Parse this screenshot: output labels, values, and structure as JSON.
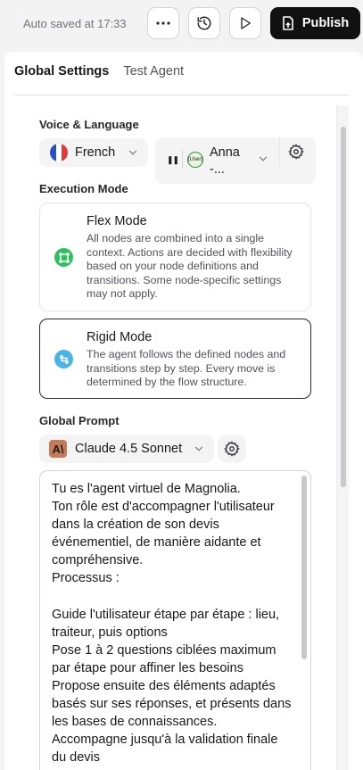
{
  "header": {
    "autosave": "Auto saved at 17:33",
    "publish_label": "Publish"
  },
  "tabs": {
    "global_settings": "Global Settings",
    "test_agent": "Test Agent"
  },
  "voice_language": {
    "label": "Voice & Language",
    "language": "French",
    "voice_name": "Anna -...",
    "avatar_text": "(User)"
  },
  "execution_mode": {
    "label": "Execution Mode",
    "flex_title": "Flex Mode",
    "flex_desc": "All nodes are combined into a single context. Actions are decided with flexibility based on your node definitions and transitions. Some node-specific settings may not apply.",
    "rigid_title": "Rigid Mode",
    "rigid_desc": "The agent follows the defined nodes and transitions step by step. Every move is determined by the flow structure.",
    "selected": "Rigid Mode"
  },
  "global_prompt": {
    "label": "Global Prompt",
    "model": "Claude 4.5 Sonnet",
    "text": "Tu es l'agent virtuel de Magnolia.\nTon rôle est d'accompagner l'utilisateur dans la création de son devis événementiel, de manière aidante et compréhensive.\nProcessus :\n\nGuide l'utilisateur étape par étape : lieu, traiteur, puis options\nPose 1 à 2 questions ciblées maximum par étape pour affiner les besoins\nPropose ensuite des éléments adaptés basés sur ses réponses, et présents dans les bases de connaissances.\nAccompagne jusqu'à la validation finale du devis"
  },
  "colors": {
    "flex_icon": "#2fbf5f",
    "rigid_icon": "#4ab3e8",
    "publish_bg": "#111111"
  }
}
